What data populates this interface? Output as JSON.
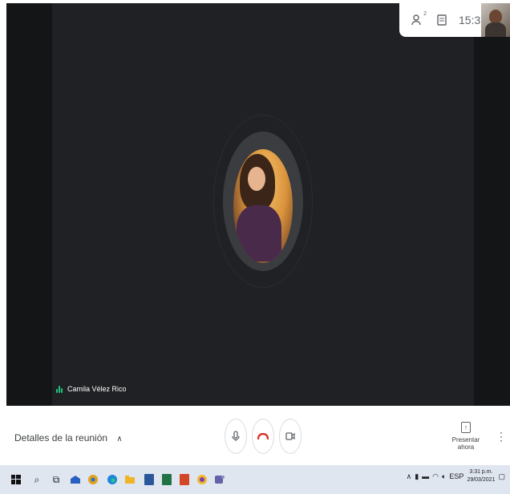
{
  "meeting": {
    "participant": {
      "name": "Camila Vélez Rico"
    }
  },
  "topbar": {
    "participants_icon": "people-icon",
    "participants_count": "2",
    "chat_icon": "chat-icon",
    "time": "15:31"
  },
  "controls": {
    "details_label": "Detalles de la reunión",
    "mic_icon": "microphone-icon",
    "hangup_icon": "call-end-icon",
    "camera_icon": "camera-icon",
    "present_label": "Presentar ahora",
    "present_icon": "present-screen-icon",
    "more_icon": "more-vert-icon",
    "hangup_color": "#d93025"
  },
  "taskbar": {
    "apps": [
      {
        "icon": "windows-start-icon",
        "color": "#1a1a1a"
      },
      {
        "icon": "search-icon",
        "color": "#1a1a1a"
      },
      {
        "icon": "task-view-icon",
        "color": "#1a1a1a"
      },
      {
        "icon": "mail-icon",
        "color": "#2a5fbf"
      },
      {
        "icon": "chrome-icon",
        "color": "#e0a21a"
      },
      {
        "icon": "edge-icon",
        "color": "#1b87d8"
      },
      {
        "icon": "file-explorer-icon",
        "color": "#f0b429"
      },
      {
        "icon": "word-icon",
        "color": "#2b579a"
      },
      {
        "icon": "excel-icon",
        "color": "#217346"
      },
      {
        "icon": "powerpoint-icon",
        "color": "#d24726"
      },
      {
        "icon": "chrome-alt-icon",
        "color": "#7b3fb8"
      },
      {
        "icon": "teams-icon",
        "color": "#6264a7"
      }
    ],
    "tray": {
      "language": "ESP",
      "time": "3:31 p.m.",
      "date": "29/03/2021"
    }
  }
}
